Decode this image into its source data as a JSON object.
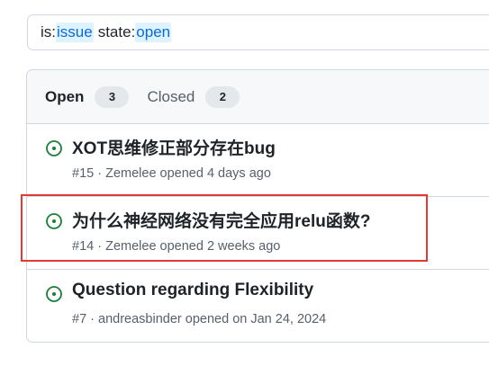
{
  "search": {
    "tokens": [
      {
        "key": "is:",
        "value": "issue"
      },
      {
        "key": "state:",
        "value": "open"
      }
    ]
  },
  "filters": {
    "open": {
      "label": "Open",
      "count": "3"
    },
    "closed": {
      "label": "Closed",
      "count": "2"
    }
  },
  "issues": [
    {
      "title": "XOT思维修正部分存在bug",
      "number": "#15",
      "author": "Zemelee",
      "opened": "opened 4 days ago",
      "state": "open"
    },
    {
      "title": "为什么神经网络没有完全应用relu函数?",
      "number": "#14",
      "author": "Zemelee",
      "opened": "opened 2 weeks ago",
      "state": "open"
    },
    {
      "title": "Question regarding Flexibility",
      "number": "#7",
      "author": "andreasbinder",
      "opened": "opened on Jan 24, 2024",
      "state": "open"
    }
  ],
  "colors": {
    "open_icon": "#1a7f37",
    "highlight": "#e53935",
    "search_highlight_bg": "#ddf4ff",
    "search_highlight_fg": "#0969da"
  }
}
